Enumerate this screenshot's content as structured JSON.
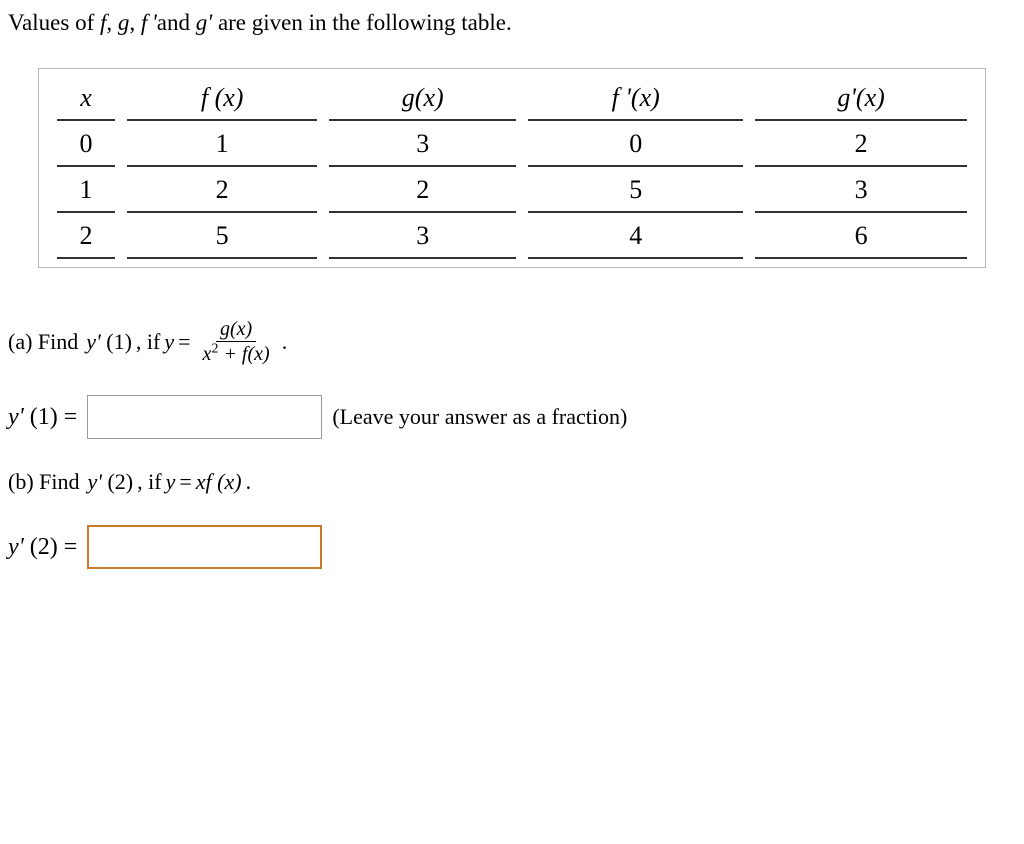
{
  "intro": {
    "prefix": "Values of ",
    "f": "f",
    "g": "g",
    "fprime": "f '",
    "and": "and ",
    "gprime": "g'",
    "suffix": " are given in the following table.",
    "comma": ", "
  },
  "table": {
    "headers": {
      "x": "x",
      "fx": "f (x)",
      "gx": "g(x)",
      "fpx": "f '(x)",
      "gpx": "g'(x)"
    },
    "rows": [
      {
        "x": "0",
        "fx": "1",
        "gx": "3",
        "fpx": "0",
        "gpx": "2"
      },
      {
        "x": "1",
        "fx": "2",
        "gx": "2",
        "fpx": "5",
        "gpx": "3"
      },
      {
        "x": "2",
        "fx": "5",
        "gx": "3",
        "fpx": "4",
        "gpx": "6"
      }
    ]
  },
  "partA": {
    "label": "(a) Find ",
    "yprime": "y'",
    "arg": " (1)",
    "ify": ", if ",
    "y": "y",
    "eq": " = ",
    "frac_num": "g(x)",
    "frac_den_left": "x",
    "frac_den_sup": "2",
    "frac_den_right": " + f(x)",
    "period": "."
  },
  "answerA": {
    "lhs_y": "y'",
    "lhs_arg": " (1) = ",
    "value": "",
    "hint": "(Leave your answer as a fraction)"
  },
  "partB": {
    "label": "(b) Find ",
    "yprime": "y'",
    "arg": " (2)",
    "ify": ", if ",
    "y": "y",
    "eq": " = ",
    "rhs": "xf (x)",
    "period": "."
  },
  "answerB": {
    "lhs_y": "y'",
    "lhs_arg": " (2) = ",
    "value": ""
  }
}
